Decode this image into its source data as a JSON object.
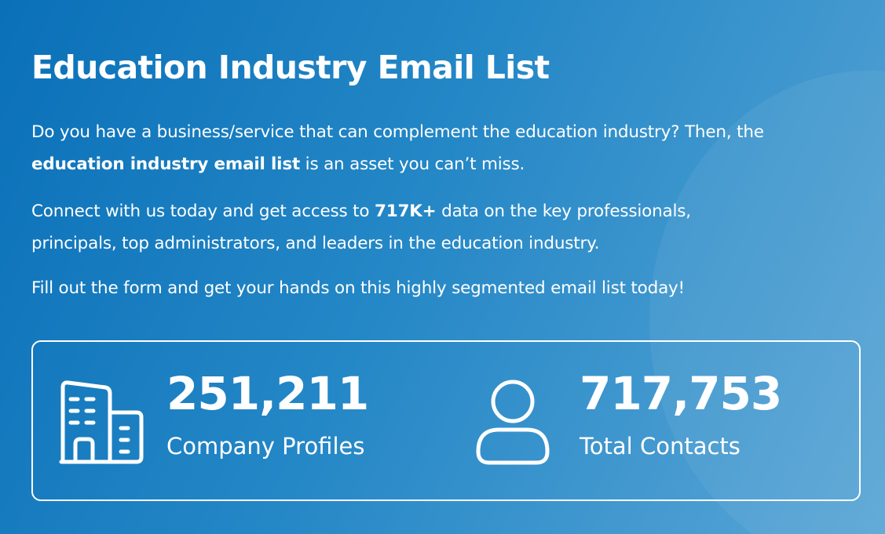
{
  "page": {
    "title": "Education Industry Email List",
    "paragraphs": [
      {
        "line1": "Do you have a business/service that can complement the education industry? Then, the",
        "bold": "education industry email list",
        "rest": " is an asset you can’t miss."
      },
      {
        "before": "Connect with us today and get access to ",
        "bold": "717K+",
        "after": " data on the key professionals,",
        "line2": "principals, top administrators, and leaders in the education industry."
      },
      {
        "text": "Fill out the form and get your hands on this highly segmented email list today!"
      }
    ]
  },
  "stats": [
    {
      "icon": "building-icon",
      "value": "251,211",
      "label": "Company Profiles"
    },
    {
      "icon": "user-icon",
      "value": "717,753",
      "label": "Total Contacts"
    }
  ],
  "colors": {
    "background_start": "#0a70b8",
    "background_end": "#5aa6d6",
    "text": "#ffffff"
  }
}
